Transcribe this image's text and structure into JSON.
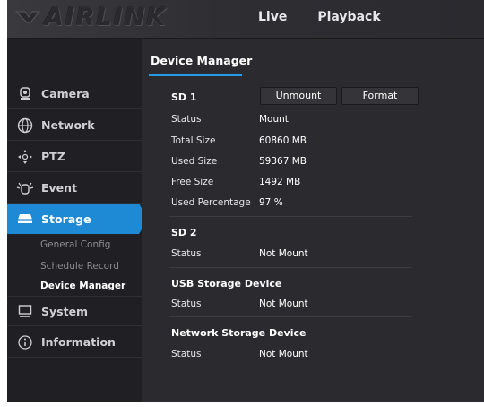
{
  "brand": {
    "logo_text": "AIRLINK"
  },
  "topnav": {
    "live": "Live",
    "playback": "Playback"
  },
  "sidebar": {
    "items": [
      {
        "label": "Camera",
        "icon": "camera-icon"
      },
      {
        "label": "Network",
        "icon": "network-globe-icon"
      },
      {
        "label": "PTZ",
        "icon": "ptz-arrows-icon"
      },
      {
        "label": "Event",
        "icon": "event-alarm-icon"
      },
      {
        "label": "Storage",
        "icon": "storage-drive-icon",
        "active": true
      },
      {
        "label": "System",
        "icon": "monitor-icon"
      },
      {
        "label": "Information",
        "icon": "info-icon"
      }
    ],
    "storage_sub": [
      "General Config",
      "Schedule Record",
      "Device Manager"
    ],
    "accent": "#1e8ad6"
  },
  "main": {
    "tab": "Device Manager",
    "sd1": {
      "title": "SD 1",
      "unmount_label": "Unmount",
      "format_label": "Format",
      "rows": [
        {
          "label": "Status",
          "value": "Mount"
        },
        {
          "label": "Total Size",
          "value": "60860 MB"
        },
        {
          "label": "Used Size",
          "value": "59367 MB"
        },
        {
          "label": "Free Size",
          "value": "1492 MB"
        },
        {
          "label": "Used Percentage",
          "value": "97 %"
        }
      ]
    },
    "sd2": {
      "title": "SD 2",
      "status_label": "Status",
      "status_value": "Not Mount"
    },
    "usb": {
      "title": "USB Storage Device",
      "status_label": "Status",
      "status_value": "Not Mount"
    },
    "network": {
      "title": "Network Storage Device",
      "status_label": "Status",
      "status_value": "Not Mount"
    }
  }
}
